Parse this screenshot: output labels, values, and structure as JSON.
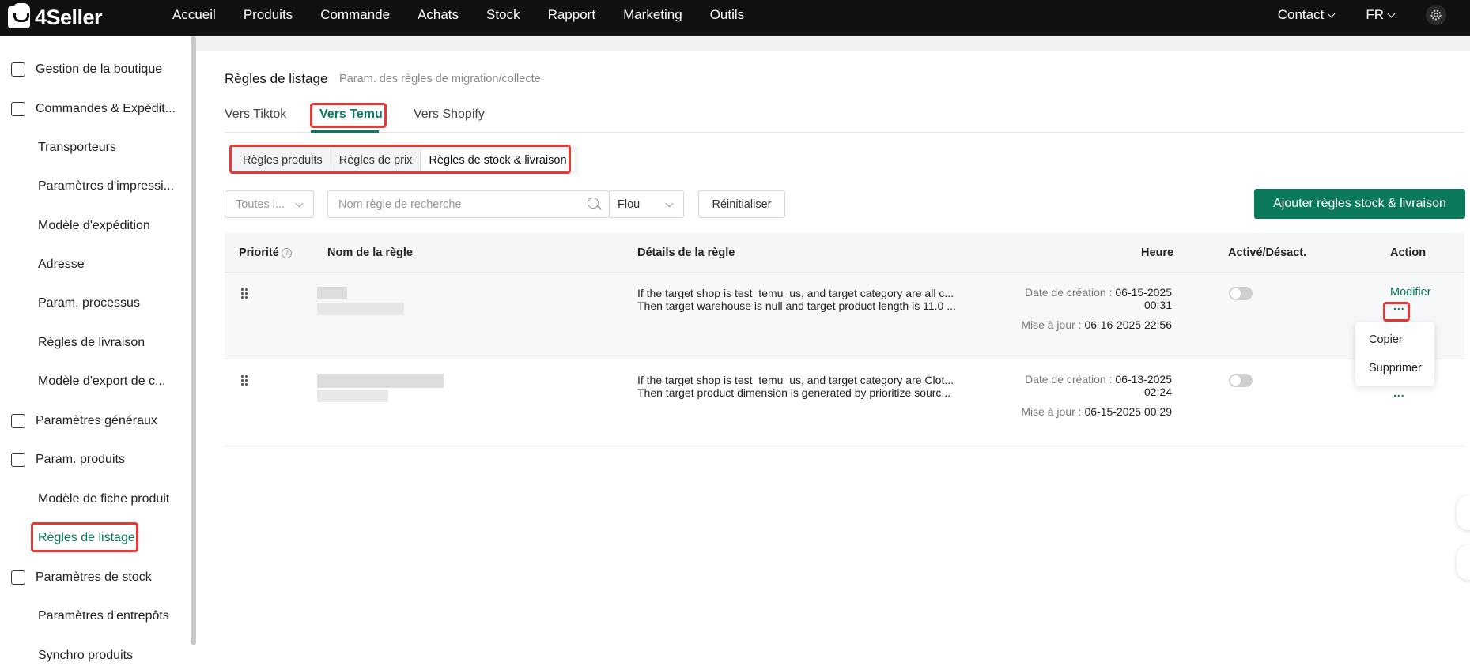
{
  "app": {
    "logo": "4Seller"
  },
  "nav": [
    "Accueil",
    "Produits",
    "Commande",
    "Achats",
    "Stock",
    "Rapport",
    "Marketing",
    "Outils"
  ],
  "top_right": {
    "contact": "Contact",
    "lang": "FR",
    "settings_icon": "gear-icon"
  },
  "sidebar": {
    "items": [
      {
        "label": "Gestion de la boutique",
        "type": "parent",
        "icon": "store-icon"
      },
      {
        "label": "Commandes & Expédit...",
        "type": "parent",
        "icon": "order-icon"
      },
      {
        "label": "Transporteurs",
        "type": "child"
      },
      {
        "label": "Paramètres d'impressi...",
        "type": "child"
      },
      {
        "label": "Modèle d'expédition",
        "type": "child"
      },
      {
        "label": "Adresse",
        "type": "child"
      },
      {
        "label": "Param. processus",
        "type": "child"
      },
      {
        "label": "Règles de livraison",
        "type": "child"
      },
      {
        "label": "Modèle d'export de c...",
        "type": "child"
      },
      {
        "label": "Paramètres généraux",
        "type": "parent",
        "icon": "printer-icon"
      },
      {
        "label": "Param. produits",
        "type": "parent",
        "icon": "upload-box-icon"
      },
      {
        "label": "Modèle de fiche produit",
        "type": "child"
      },
      {
        "label": "Règles de listage",
        "type": "child",
        "active": true
      },
      {
        "label": "Paramètres de stock",
        "type": "parent",
        "icon": "warehouse-icon"
      },
      {
        "label": "Paramètres d'entrepôts",
        "type": "child"
      },
      {
        "label": "Synchro produits",
        "type": "child"
      }
    ]
  },
  "page": {
    "title": "Règles de listage",
    "subtitle": "Param. des règles de migration/collecte",
    "tabs": [
      "Vers Tiktok",
      "Vers Temu",
      "Vers Shopify"
    ],
    "active_tab": "Vers Temu",
    "segments": [
      "Règles produits",
      "Règles de prix",
      "Règles de stock & livraison"
    ],
    "active_segment": "Règles de stock & livraison"
  },
  "filters": {
    "shop_select": "Toutes l...",
    "search_placeholder": "Nom règle de recherche",
    "match_select": "Flou",
    "reset": "Réinitialiser",
    "add_button": "Ajouter règles stock & livraison"
  },
  "table": {
    "headers": [
      "Priorité",
      "Nom de la règle",
      "Détails de la règle",
      "Heure",
      "Activé/Désact.",
      "Action"
    ],
    "rows": [
      {
        "details": [
          "If the target shop is test_temu_us, and target category are all c...",
          "Then target warehouse is null and target product length is 11.0 ..."
        ],
        "created_label": "Date de création :",
        "created": "06-15-2025 00:31",
        "updated_label": "Mise à jour :",
        "updated": "06-16-2025 22:56",
        "enabled": false,
        "edit": "Modifier",
        "more": "..."
      },
      {
        "details": [
          "If the target shop is test_temu_us, and target category are Clot...",
          "Then target product dimension is generated by prioritize sourc..."
        ],
        "created_label": "Date de création :",
        "created": "06-13-2025 02:24",
        "updated_label": "Mise à jour :",
        "updated": "06-15-2025 00:29",
        "enabled": false,
        "more": "..."
      }
    ]
  },
  "dropdown": {
    "items": [
      "Copier",
      "Supprimer"
    ]
  },
  "colors": {
    "brand": "#0b7a5c",
    "highlight": "#e53935",
    "topbar": "#111111"
  }
}
